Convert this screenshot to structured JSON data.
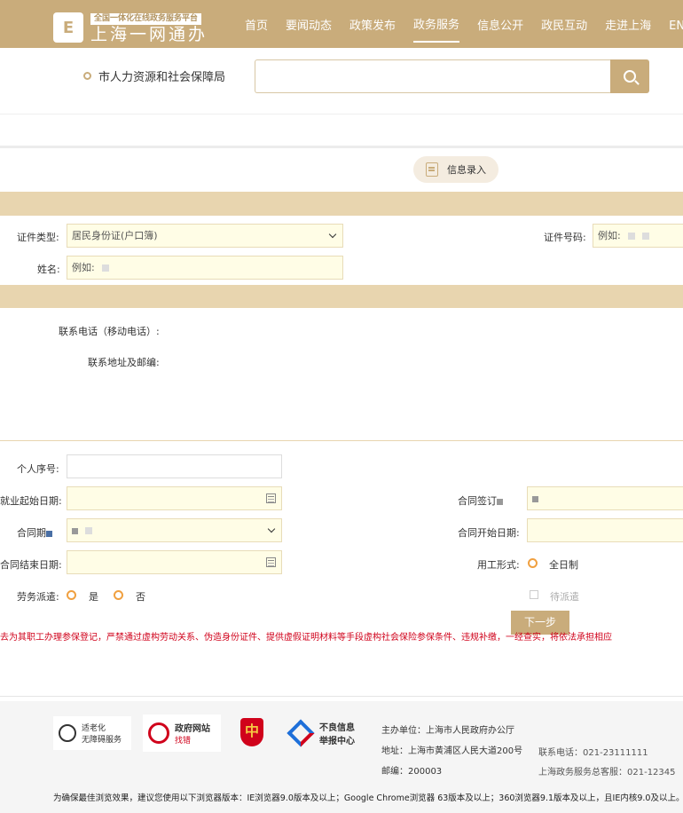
{
  "header": {
    "logo_sub": "全国一体化在线政务服务平台",
    "logo_main": "上海一网通办",
    "logo_icon_char": "E",
    "nav": [
      "首页",
      "要闻动态",
      "政策发布",
      "政务服务",
      "信息公开",
      "政民互动",
      "走进上海",
      "EN"
    ],
    "active_nav": "政务服务"
  },
  "search": {
    "department": "市人力资源和社会保障局",
    "placeholder": ""
  },
  "step": {
    "label": "信息录入"
  },
  "form": {
    "id_type_label": "证件类型:",
    "id_type_value": "居民身份证(户口簿)",
    "id_number_label": "证件号码:",
    "id_number_placeholder": "例如:",
    "name_label": "姓名:",
    "name_placeholder": "例如:",
    "phone_label": "联系电话（移动电话）:",
    "address_label": "联系地址及邮编:",
    "personal_no_label": "个人序号:",
    "employment_start_label": "就业起始日期:",
    "contract_sign_label": "合同签订",
    "contract_term_label": "合同期",
    "contract_start_label": "合同开始日期:",
    "contract_end_label": "合同结束日期:",
    "work_form_label": "用工形式:",
    "work_form_option": "全日制",
    "dispatch_label": "劳务派遣:",
    "dispatch_yes": "是",
    "dispatch_no": "否",
    "pending_dispatch": "待派遣"
  },
  "next_button": "下一步",
  "warning": "去为其职工办理参保登记，严禁通过虚构劳动关系、伪造身份证件、提供虚假证明材料等手段虚构社会保险参保条件、违规补缴，一经查实，将依法承担相应",
  "footer": {
    "logo1_line1": "适老化",
    "logo1_line2": "无障碍服务",
    "logo2_line1": "政府网站",
    "logo2_line2": "找错",
    "logo3_char": "中",
    "logo4_line1": "不良信息",
    "logo4_line2": "举报中心",
    "sponsor": "主办单位：上海市人民政府办公厅",
    "address": "地址：上海市黄浦区人民大道200号",
    "postcode": "邮编：200003",
    "phone": "联系电话：021-23111111",
    "hotline": "上海政务服务总客服：021-12345",
    "browser_note": "为确保最佳浏览效果，建议您使用以下浏览器版本：IE浏览器9.0版本及以上；Google Chrome浏览器 63版本及以上；360浏览器9.1版本及以上，且IE内核9.0及以上。"
  }
}
